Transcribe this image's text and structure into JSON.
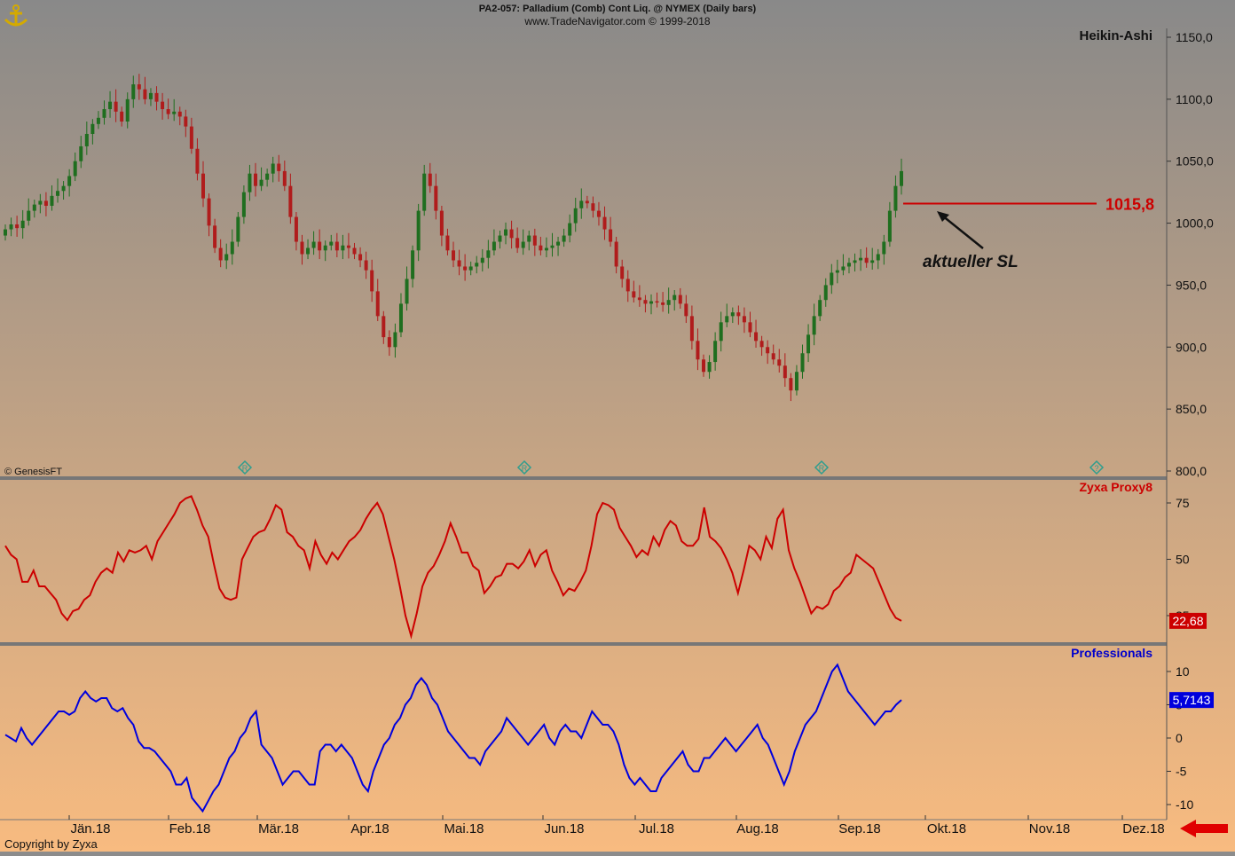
{
  "header": {
    "title": "PA2-057:  Palladium (Comb) Cont Liq. @ NYMEX  (Daily bars)",
    "subtitle": "www.TradeNavigator.com © 1999-2018"
  },
  "footer": {
    "copyright": "Copyright by Zyxa",
    "watermark": "© GenesisFT"
  },
  "colors": {
    "bg_top": "#898989",
    "bg_bottom": "#f8bb80",
    "candle_up": "#1f6e1f",
    "candle_down": "#b01c1c",
    "proxy_line": "#cc0000",
    "prof_line": "#0000dd",
    "sl_line": "#cc0000"
  },
  "chart_data": [
    {
      "type": "candlestick",
      "name": "Heikin-Ashi",
      "title": "Heikin-Ashi",
      "ylim": [
        800,
        1160
      ],
      "yticks": [
        "1150,0",
        "1100,0",
        "1050,0",
        "1000,0",
        "950,0",
        "900,0",
        "850,0",
        "800,0"
      ],
      "ytick_values": [
        1150,
        1100,
        1050,
        1000,
        950,
        900,
        850,
        800
      ],
      "x_months": [
        "Jän.18",
        "Feb.18",
        "Mär.18",
        "Apr.18",
        "Mai.18",
        "Jun.18",
        "Jul.18",
        "Aug.18",
        "Sep.18",
        "Okt.18",
        "Nov.18",
        "Dez.18"
      ],
      "closes": [
        995,
        999,
        996,
        1002,
        1010,
        1015,
        1018,
        1014,
        1022,
        1026,
        1030,
        1038,
        1050,
        1062,
        1072,
        1080,
        1085,
        1092,
        1098,
        1090,
        1082,
        1100,
        1112,
        1108,
        1100,
        1105,
        1098,
        1092,
        1088,
        1090,
        1086,
        1078,
        1060,
        1040,
        1020,
        998,
        980,
        970,
        975,
        985,
        1005,
        1025,
        1040,
        1030,
        1035,
        1040,
        1048,
        1042,
        1030,
        1005,
        985,
        975,
        980,
        985,
        978,
        982,
        985,
        978,
        982,
        980,
        975,
        970,
        962,
        945,
        925,
        908,
        900,
        912,
        935,
        955,
        978,
        1010,
        1040,
        1030,
        1010,
        990,
        978,
        970,
        965,
        962,
        965,
        968,
        972,
        978,
        985,
        990,
        995,
        988,
        980,
        985,
        990,
        982,
        978,
        980,
        982,
        985,
        990,
        1000,
        1012,
        1018,
        1016,
        1010,
        1005,
        995,
        985,
        965,
        955,
        945,
        940,
        938,
        935,
        937,
        936,
        934,
        938,
        942,
        935,
        925,
        905,
        890,
        880,
        888,
        905,
        920,
        925,
        928,
        925,
        920,
        912,
        905,
        900,
        895,
        890,
        885,
        875,
        865,
        880,
        895,
        910,
        925,
        938,
        950,
        960,
        962,
        965,
        968,
        970,
        972,
        968,
        970,
        975,
        985,
        1010,
        1030,
        1042
      ],
      "opens": [
        990,
        995,
        999,
        996,
        1002,
        1010,
        1015,
        1018,
        1014,
        1022,
        1026,
        1030,
        1038,
        1050,
        1062,
        1072,
        1080,
        1085,
        1092,
        1098,
        1090,
        1082,
        1100,
        1112,
        1108,
        1100,
        1105,
        1098,
        1092,
        1088,
        1090,
        1086,
        1078,
        1060,
        1040,
        1020,
        998,
        980,
        970,
        975,
        985,
        1005,
        1025,
        1040,
        1030,
        1035,
        1040,
        1048,
        1042,
        1030,
        1005,
        985,
        975,
        980,
        985,
        978,
        982,
        985,
        978,
        982,
        980,
        975,
        970,
        962,
        945,
        925,
        908,
        900,
        912,
        935,
        955,
        978,
        1010,
        1040,
        1030,
        1010,
        990,
        978,
        970,
        965,
        962,
        965,
        968,
        972,
        978,
        985,
        990,
        995,
        988,
        980,
        985,
        990,
        982,
        978,
        980,
        982,
        985,
        990,
        1000,
        1012,
        1018,
        1016,
        1010,
        1005,
        995,
        985,
        965,
        955,
        945,
        940,
        938,
        935,
        937,
        936,
        934,
        938,
        942,
        935,
        925,
        905,
        890,
        880,
        888,
        905,
        920,
        925,
        928,
        925,
        920,
        912,
        905,
        900,
        895,
        890,
        885,
        875,
        865,
        880,
        895,
        910,
        925,
        938,
        950,
        960,
        962,
        965,
        968,
        970,
        972,
        968,
        970,
        975,
        985,
        1010,
        1030
      ],
      "annotations": [
        {
          "label": "1015,8",
          "value": 1015.8
        },
        {
          "label": "aktueller SL"
        }
      ],
      "markers": [
        "R",
        "R",
        "R",
        "?"
      ]
    },
    {
      "type": "line",
      "name": "Zyxa Proxy8",
      "title": "Zyxa Proxy8",
      "ylim": [
        12,
        82
      ],
      "yticks": [
        "75",
        "50",
        "25"
      ],
      "ytick_values": [
        75,
        50,
        25
      ],
      "last_value_label": "22,68",
      "values": [
        56,
        52,
        50,
        40,
        40,
        45,
        38,
        38,
        35,
        32,
        26,
        23,
        27,
        28,
        32,
        34,
        40,
        44,
        46,
        44,
        53,
        49,
        54,
        53,
        54,
        56,
        50,
        58,
        62,
        66,
        70,
        75,
        77,
        78,
        72,
        65,
        60,
        48,
        37,
        33,
        32,
        33,
        50,
        55,
        60,
        62,
        63,
        68,
        74,
        72,
        62,
        60,
        56,
        54,
        46,
        58,
        52,
        48,
        53,
        50,
        54,
        58,
        60,
        63,
        68,
        72,
        75,
        70,
        60,
        50,
        38,
        25,
        16,
        26,
        38,
        44,
        47,
        52,
        58,
        66,
        60,
        53,
        53,
        47,
        45,
        35,
        38,
        42,
        43,
        48,
        48,
        46,
        49,
        54,
        47,
        52,
        54,
        45,
        40,
        34,
        37,
        36,
        40,
        45,
        56,
        70,
        75,
        74,
        72,
        64,
        60,
        56,
        51,
        54,
        52,
        60,
        56,
        63,
        67,
        65,
        58,
        56,
        56,
        59,
        73,
        60,
        58,
        55,
        50,
        44,
        35,
        45,
        56,
        54,
        50,
        60,
        55,
        68,
        72,
        54,
        46,
        40,
        33,
        26,
        29,
        28,
        30,
        36,
        38,
        42,
        44,
        52,
        50,
        48,
        46,
        40,
        34,
        28,
        24,
        22.68
      ],
      "values_note_removed": true
    },
    {
      "type": "line",
      "name": "Professionals",
      "title": "Professionals",
      "ylim": [
        -12,
        13.5
      ],
      "yticks": [
        "10",
        "5",
        "0",
        "-5",
        "-10"
      ],
      "ytick_values": [
        10,
        5,
        0,
        -5,
        -10
      ],
      "last_value_label": "5,7143",
      "values": [
        0.5,
        0,
        -0.5,
        1.5,
        0,
        -1,
        0,
        1,
        2,
        3,
        4,
        4,
        3.5,
        4,
        6,
        7,
        6,
        5.5,
        6,
        6,
        4.5,
        4,
        4.5,
        3,
        2,
        -0.5,
        -1.5,
        -1.5,
        -2,
        -3,
        -4,
        -5,
        -7,
        -7,
        -6,
        -9,
        -10,
        -11,
        -9.5,
        -8,
        -7,
        -5,
        -3,
        -2,
        0,
        1,
        3,
        4,
        -1,
        -2,
        -3,
        -5,
        -7,
        -6,
        -5,
        -5,
        -6,
        -7,
        -7,
        -2,
        -1,
        -1,
        -2,
        -1,
        -2,
        -3,
        -5,
        -7,
        -8,
        -5,
        -3,
        -1,
        0,
        2,
        3,
        5,
        6,
        8,
        9,
        8,
        6,
        5,
        3,
        1,
        0,
        -1,
        -2,
        -3,
        -3,
        -4,
        -2,
        -1,
        0,
        1,
        3,
        2,
        1,
        0,
        -1,
        0,
        1,
        2,
        0,
        -1,
        1,
        2,
        1,
        1,
        0,
        2,
        4,
        3,
        2,
        2,
        1,
        -1,
        -4,
        -6,
        -7,
        -6,
        -7,
        -8,
        -8,
        -6,
        -5,
        -4,
        -3,
        -2,
        -4,
        -5,
        -5,
        -3,
        -3,
        -2,
        -1,
        0,
        -1,
        -2,
        -1,
        0,
        1,
        2,
        0,
        -1,
        -3,
        -5,
        -7,
        -5,
        -2,
        0,
        2,
        3,
        4,
        6,
        8,
        10,
        11,
        9,
        7,
        6,
        5,
        4,
        3,
        2,
        3,
        4,
        4,
        5,
        5.7143
      ]
    }
  ]
}
